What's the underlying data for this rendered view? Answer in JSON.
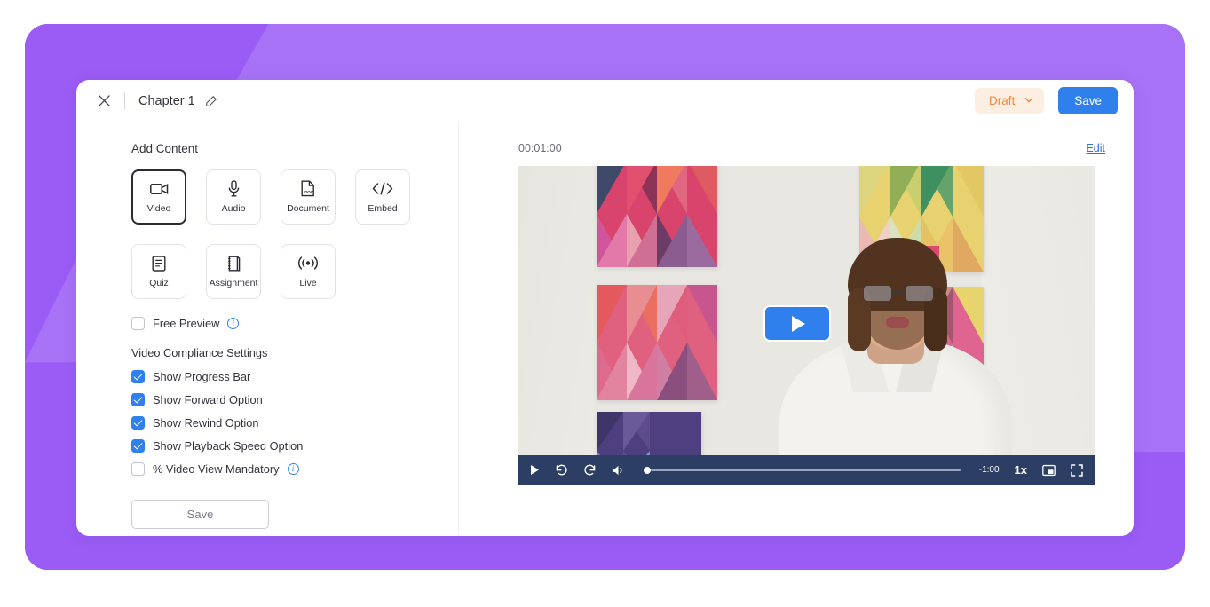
{
  "theme": {
    "backdrop_purple": "#9a5cf5",
    "backdrop_purple_light": "#a872f7",
    "accent_blue": "#2f80ed",
    "draft_orange": "#f3863a",
    "draft_bg": "#fdeee2",
    "control_bar": "#2c3e63"
  },
  "header": {
    "close_icon": "close-icon",
    "title": "Chapter 1",
    "edit_icon": "edit-pencil-icon",
    "status_label": "Draft",
    "status_chevron": "chevron-down-icon",
    "save_label": "Save"
  },
  "left_pane": {
    "add_content_title": "Add Content",
    "content_types": [
      {
        "label": "Video",
        "icon": "video-camera-icon",
        "selected": true
      },
      {
        "label": "Audio",
        "icon": "microphone-icon",
        "selected": false
      },
      {
        "label": "Document",
        "icon": "document-doc-icon",
        "selected": false
      },
      {
        "label": "Embed",
        "icon": "code-brackets-icon",
        "selected": false
      },
      {
        "label": "Quiz",
        "icon": "quiz-list-icon",
        "selected": false
      },
      {
        "label": "Assignment",
        "icon": "assignment-notebook-icon",
        "selected": false
      },
      {
        "label": "Live",
        "icon": "live-broadcast-icon",
        "selected": false
      }
    ],
    "free_preview": {
      "label": "Free Preview",
      "checked": false,
      "info": true
    },
    "compliance_title": "Video Compliance Settings",
    "compliance_options": [
      {
        "label": "Show Progress Bar",
        "checked": true,
        "info": false
      },
      {
        "label": "Show Forward Option",
        "checked": true,
        "info": false
      },
      {
        "label": "Show Rewind Option",
        "checked": true,
        "info": false
      },
      {
        "label": "Show Playback Speed Option",
        "checked": true,
        "info": false
      },
      {
        "label": "% Video View Mandatory",
        "checked": false,
        "info": true
      }
    ],
    "save_label": "Save"
  },
  "right_pane": {
    "timestamp": "00:01:00",
    "edit_link": "Edit",
    "player": {
      "play_overlay_icon": "play-icon",
      "play_icon": "play-icon",
      "rewind_icon": "rewind-icon",
      "forward_icon": "fast-forward-icon",
      "volume_icon": "volume-icon",
      "remaining_time": "-1:00",
      "speed": "1x",
      "pip_icon": "picture-in-picture-icon",
      "fullscreen_icon": "fullscreen-icon"
    }
  }
}
